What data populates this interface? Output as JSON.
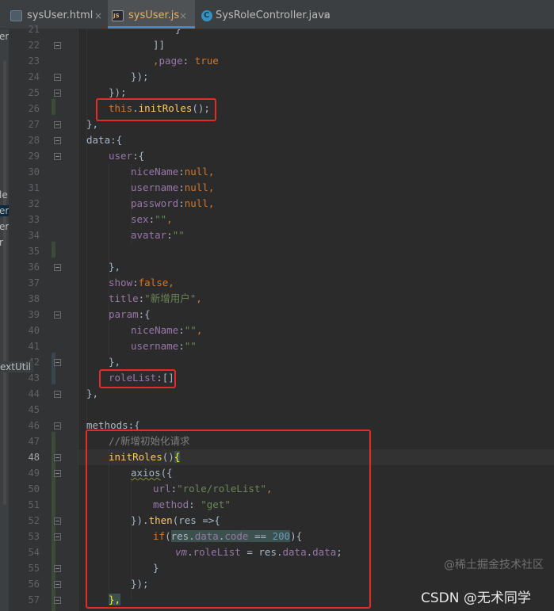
{
  "tabs": [
    {
      "label": "sysUser.html",
      "close": "×",
      "icon": "html-file-icon",
      "active": false
    },
    {
      "label": "sysUser.js",
      "close": "×",
      "icon": "js-file-icon",
      "active": true
    },
    {
      "label": "SysRoleController.java",
      "close": "×",
      "icon": "java-class-icon",
      "active": false
    }
  ],
  "project_sliver": {
    "fragments": [
      "en",
      "le",
      "er",
      "er",
      "r"
    ],
    "text_util": "extUtil"
  },
  "gutter": {
    "line_numbers": [
      "21",
      "22",
      "23",
      "24",
      "25",
      "26",
      "27",
      "28",
      "29",
      "30",
      "31",
      "32",
      "33",
      "34",
      "35",
      "36",
      "37",
      "38",
      "39",
      "40",
      "41",
      "42",
      "43",
      "44",
      "45",
      "46",
      "47",
      "48",
      "49",
      "50",
      "51",
      "52",
      "53",
      "54",
      "55",
      "56",
      "57"
    ],
    "current_line": "48"
  },
  "code": {
    "l21": {
      "brace": "}"
    },
    "l22": {
      "text": "]]"
    },
    "l23": {
      "comma": ",",
      "key": "page",
      "colon": ": ",
      "value": "true"
    },
    "l24": {
      "text": "});"
    },
    "l25": {
      "text": "});"
    },
    "l26": {
      "this": "this",
      "dot": ".",
      "fn": "initRoles",
      "rest": "();"
    },
    "l27": {
      "text": "},"
    },
    "l28": {
      "text": "data:{"
    },
    "l29": {
      "key": "user",
      "rest": ":{"
    },
    "l30": {
      "key": "niceName",
      "colon": ":",
      "value": "null",
      "comma": ","
    },
    "l31": {
      "key": "username",
      "colon": ":",
      "value": "null",
      "comma": ","
    },
    "l32": {
      "key": "password",
      "colon": ":",
      "value": "null",
      "comma": ","
    },
    "l33": {
      "key": "sex",
      "colon": ":",
      "value": "\"\"",
      "comma": ","
    },
    "l34": {
      "key": "avatar",
      "colon": ":",
      "value": "\"\""
    },
    "l36": {
      "text": "},"
    },
    "l37": {
      "key": "show",
      "colon": ":",
      "value": "false",
      "comma": ","
    },
    "l38": {
      "key": "title",
      "colon": ":",
      "value": "\"新增用户\"",
      "comma": ","
    },
    "l39": {
      "key": "param",
      "rest": ":{"
    },
    "l40": {
      "key": "niceName",
      "colon": ":",
      "value": "\"\"",
      "comma": ","
    },
    "l41": {
      "key": "username",
      "colon": ":",
      "value": "\"\""
    },
    "l42": {
      "text": "},"
    },
    "l43": {
      "key": "roleList",
      "rest": ":[]"
    },
    "l44": {
      "text": "},"
    },
    "l46": {
      "text": "methods:{"
    },
    "l47": {
      "comment": "//新增初始化请求"
    },
    "l48": {
      "fn": "initRoles",
      "paren": "()",
      "brace": "{"
    },
    "l49": {
      "fn": "axios",
      "rest": "({"
    },
    "l50": {
      "key": "url",
      "colon": ":",
      "value": "\"role/roleList\"",
      "comma": ","
    },
    "l51": {
      "key": "method",
      "colon": ": ",
      "value": "\"get\""
    },
    "l52": {
      "pre": "}).",
      "fn": "then",
      "rest": "(res =>{"
    },
    "l53": {
      "kw": "if",
      "open": "(",
      "res": "res",
      "dot1": ".",
      "p1": "data",
      "dot2": ".",
      "p2": "code",
      "op": " == ",
      "num": "200",
      "close": "){"
    },
    "l54": {
      "vm": "vm",
      "dot1": ".",
      "p1": "roleList",
      "mid": " = res.",
      "p2": "data",
      "dot2": ".",
      "p3": "data",
      "end": ";"
    },
    "l55": {
      "text": "}"
    },
    "l56": {
      "text": "});"
    },
    "l57": {
      "text": "},"
    }
  },
  "watermarks": {
    "juejin": "@稀土掘金技术社区",
    "csdn": "CSDN @无术同学"
  },
  "colors": {
    "background": "#2b2b2b",
    "gutter": "#313335",
    "keyword": "#cc7832",
    "function": "#ffc66d",
    "property": "#9876aa",
    "string": "#6a8759",
    "number": "#6897bb",
    "comment": "#808080",
    "annotation_red": "#e52a2a",
    "active_tab_text": "#e0b36b"
  }
}
